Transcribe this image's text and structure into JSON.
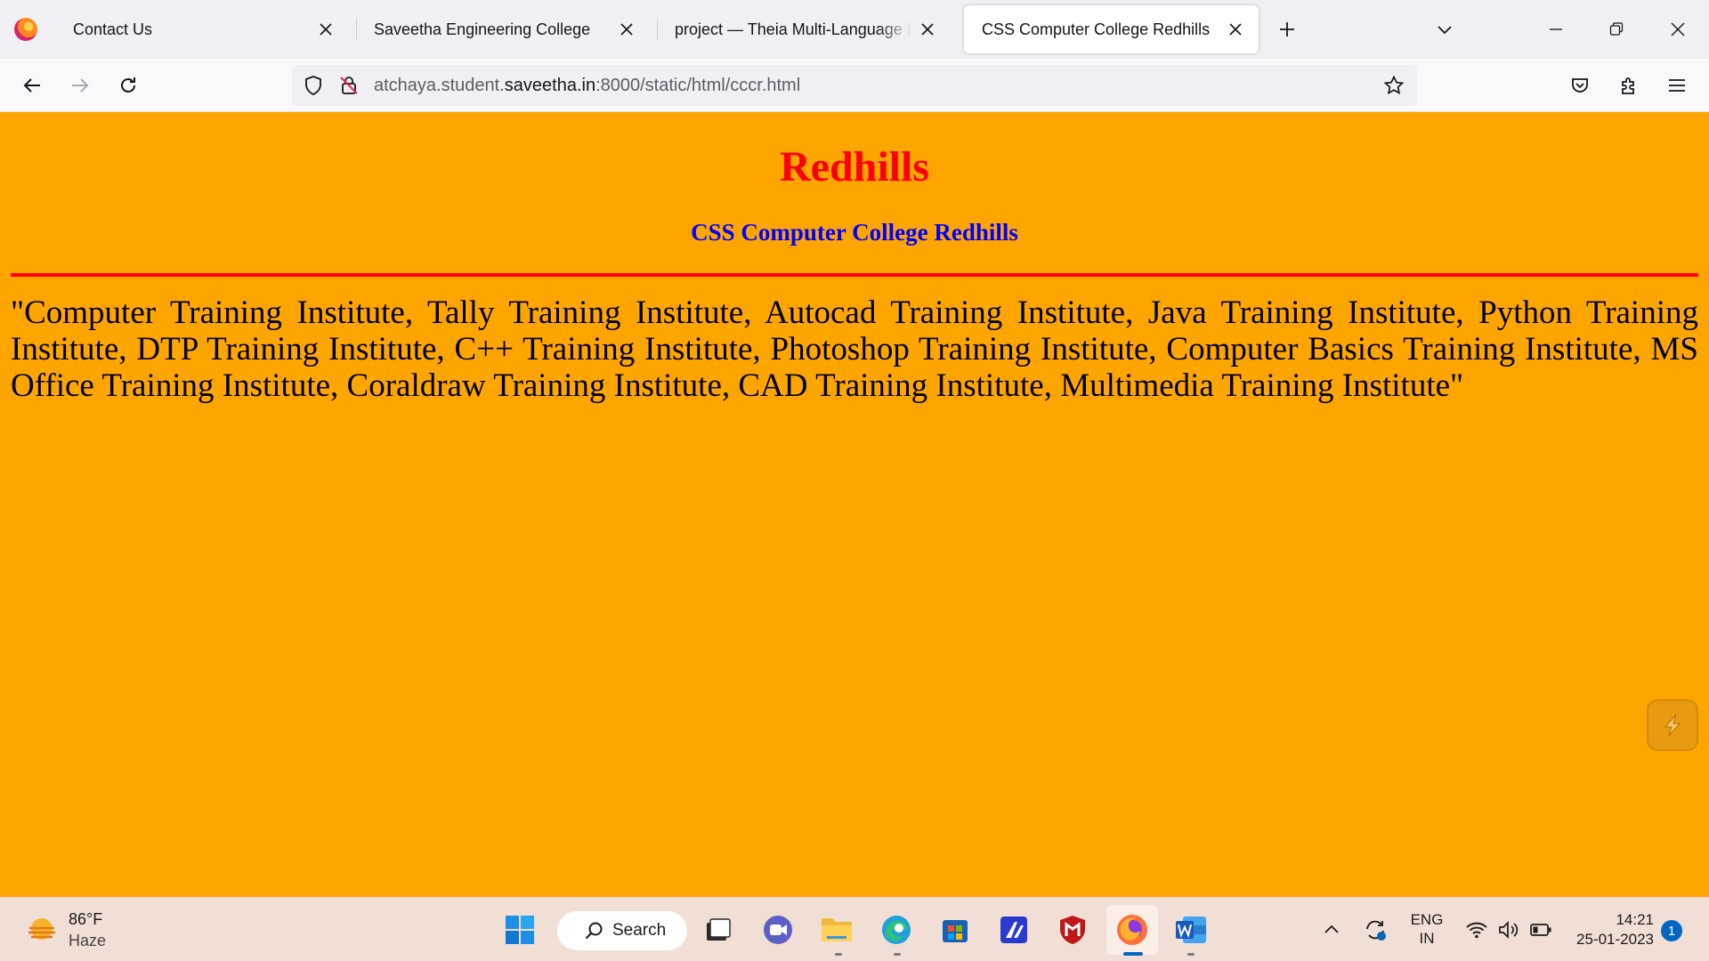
{
  "browser": {
    "tabs": [
      {
        "title": "Contact Us",
        "active": false
      },
      {
        "title": "Saveetha Engineering College",
        "active": false
      },
      {
        "title": "project — Theia Multi-Language Example",
        "active": false
      },
      {
        "title": "CSS Computer College Redhills",
        "active": true
      }
    ],
    "url_prefix": "atchaya.student.",
    "url_domain": "saveetha.in",
    "url_suffix": ":8000/static/html/cccr.html"
  },
  "page": {
    "heading": "Redhills",
    "subheading": "CSS Computer College Redhills",
    "paragraph": "\"Computer Training Institute, Tally Training Institute, Autocad Training Institute, Java Training Institute, Python Training Institute, DTP Training Institute, C++ Training Institute, Photoshop Training Institute, Computer Basics Training Institute, MS Office Training Institute, Coraldraw Training Institute, CAD Training Institute, Multimedia Training Institute\"",
    "background_color": "#ffa500",
    "heading_color": "#ff0000",
    "subheading_color": "#0000ff",
    "rule_color": "#ff0000"
  },
  "taskbar": {
    "weather_temp": "86°F",
    "weather_condition": "Haze",
    "search_label": "Search",
    "lang_line1": "ENG",
    "lang_line2": "IN",
    "time": "14:21",
    "date": "25-01-2023",
    "notification_count": "1",
    "pinned_apps": [
      "start-icon",
      "search",
      "task-view-icon",
      "chat-icon",
      "file-explorer-icon",
      "edge-icon",
      "store-icon",
      "app-icon",
      "mcafee-icon",
      "firefox-icon",
      "word-icon"
    ]
  }
}
